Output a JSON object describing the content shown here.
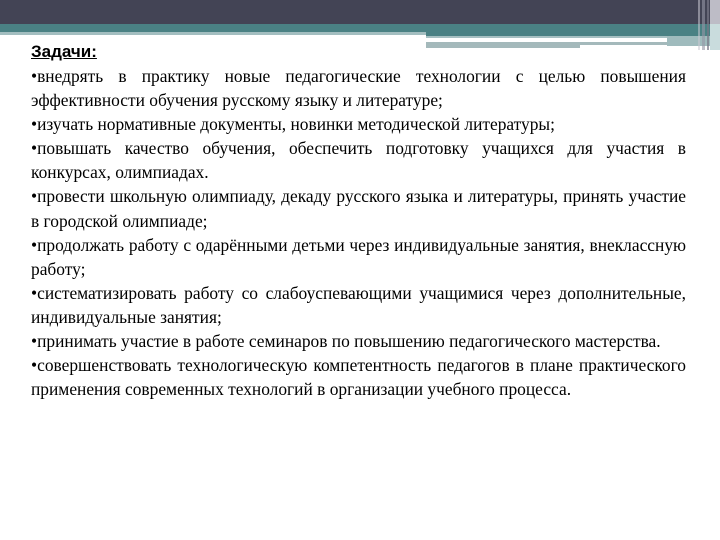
{
  "slide": {
    "heading": "Задачи:",
    "tasks": [
      {
        "bullet": "•",
        "text": "внедрять в практику новые педагогические технологии с целью повышения эффективности обучения русскому языку и литературе;"
      },
      {
        "bullet": "•",
        "text": "изучать нормативные документы, новинки методической литературы;"
      },
      {
        "bullet": "•",
        "text": "повышать качество обучения, обеспечить подготовку учащихся для участия в конкурсах, олимпиадах."
      },
      {
        "bullet": "•",
        "text": "провести школьную олимпиаду, декаду русского языка и литературы, принять участие в городской олимпиаде;"
      },
      {
        "bullet": "•",
        "text": "продолжать работу с одарёнными детьми через индивидуальные занятия, внеклассную работу;"
      },
      {
        "bullet": "•",
        "text": "систематизировать работу со слабоуспевающими учащимися через дополнительные, индивидуальные занятия;"
      },
      {
        "bullet": "•",
        "text": "принимать участие в работе семинаров по повышению педагогического мастерства."
      },
      {
        "bullet": "•",
        "text": "совершенствовать технологическую компетентность педагогов в плане практического применения современных технологий в организации учебного процесса."
      }
    ]
  },
  "theme": {
    "header_dark": "#434455",
    "header_teal": "#4a8184",
    "header_light": "#a3bec0",
    "text_color": "#000000",
    "background": "#ffffff"
  }
}
